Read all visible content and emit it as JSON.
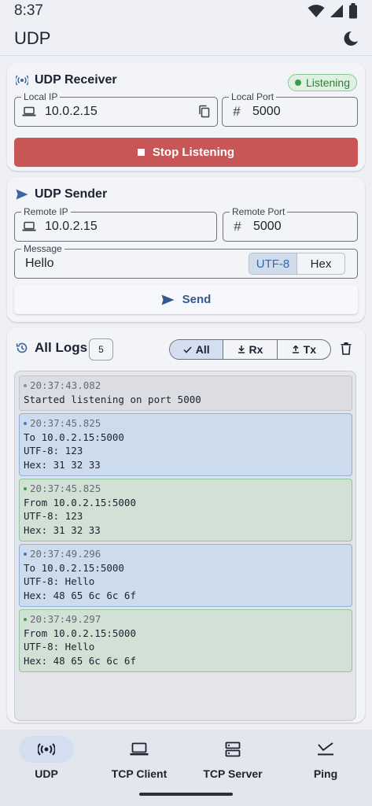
{
  "status_bar": {
    "time": "8:37"
  },
  "app_bar": {
    "title": "UDP"
  },
  "receiver": {
    "title": "UDP Receiver",
    "badge": "Listening",
    "local_ip_label": "Local IP",
    "local_ip": "10.0.2.15",
    "local_port_label": "Local Port",
    "local_port": "5000",
    "button": "Stop Listening"
  },
  "sender": {
    "title": "UDP Sender",
    "remote_ip_label": "Remote IP",
    "remote_ip": "10.0.2.15",
    "remote_port_label": "Remote Port",
    "remote_port": "5000",
    "message_label": "Message",
    "message": "Hello",
    "encoding_options": [
      "UTF-8",
      "Hex"
    ],
    "selected_encoding": "UTF-8",
    "button": "Send"
  },
  "logs": {
    "title": "All Logs",
    "count": "5",
    "filters": [
      "All",
      "Rx",
      "Tx"
    ],
    "selected_filter": "All",
    "entries": [
      {
        "kind": "info",
        "time": "20:37:43.082",
        "lines": [
          "Started listening on port 5000"
        ]
      },
      {
        "kind": "tx",
        "time": "20:37:45.825",
        "lines": [
          "To 10.0.2.15:5000",
          "UTF-8: 123",
          "Hex: 31 32 33"
        ]
      },
      {
        "kind": "rx",
        "time": "20:37:45.825",
        "lines": [
          "From 10.0.2.15:5000",
          "UTF-8: 123",
          "Hex: 31 32 33"
        ]
      },
      {
        "kind": "tx",
        "time": "20:37:49.296",
        "lines": [
          "To 10.0.2.15:5000",
          "UTF-8: Hello",
          "Hex: 48 65 6c 6c 6f"
        ]
      },
      {
        "kind": "rx",
        "time": "20:37:49.297",
        "lines": [
          "From 10.0.2.15:5000",
          "UTF-8: Hello",
          "Hex: 48 65 6c 6c 6f"
        ]
      }
    ]
  },
  "nav": {
    "items": [
      "UDP",
      "TCP Client",
      "TCP Server",
      "Ping"
    ],
    "selected": "UDP"
  },
  "colors": {
    "stop_button": "#c95656",
    "accent": "#35598f",
    "listening": "#3a9d4a",
    "tx_log": "#cddced",
    "rx_log": "#d2e0d6"
  }
}
